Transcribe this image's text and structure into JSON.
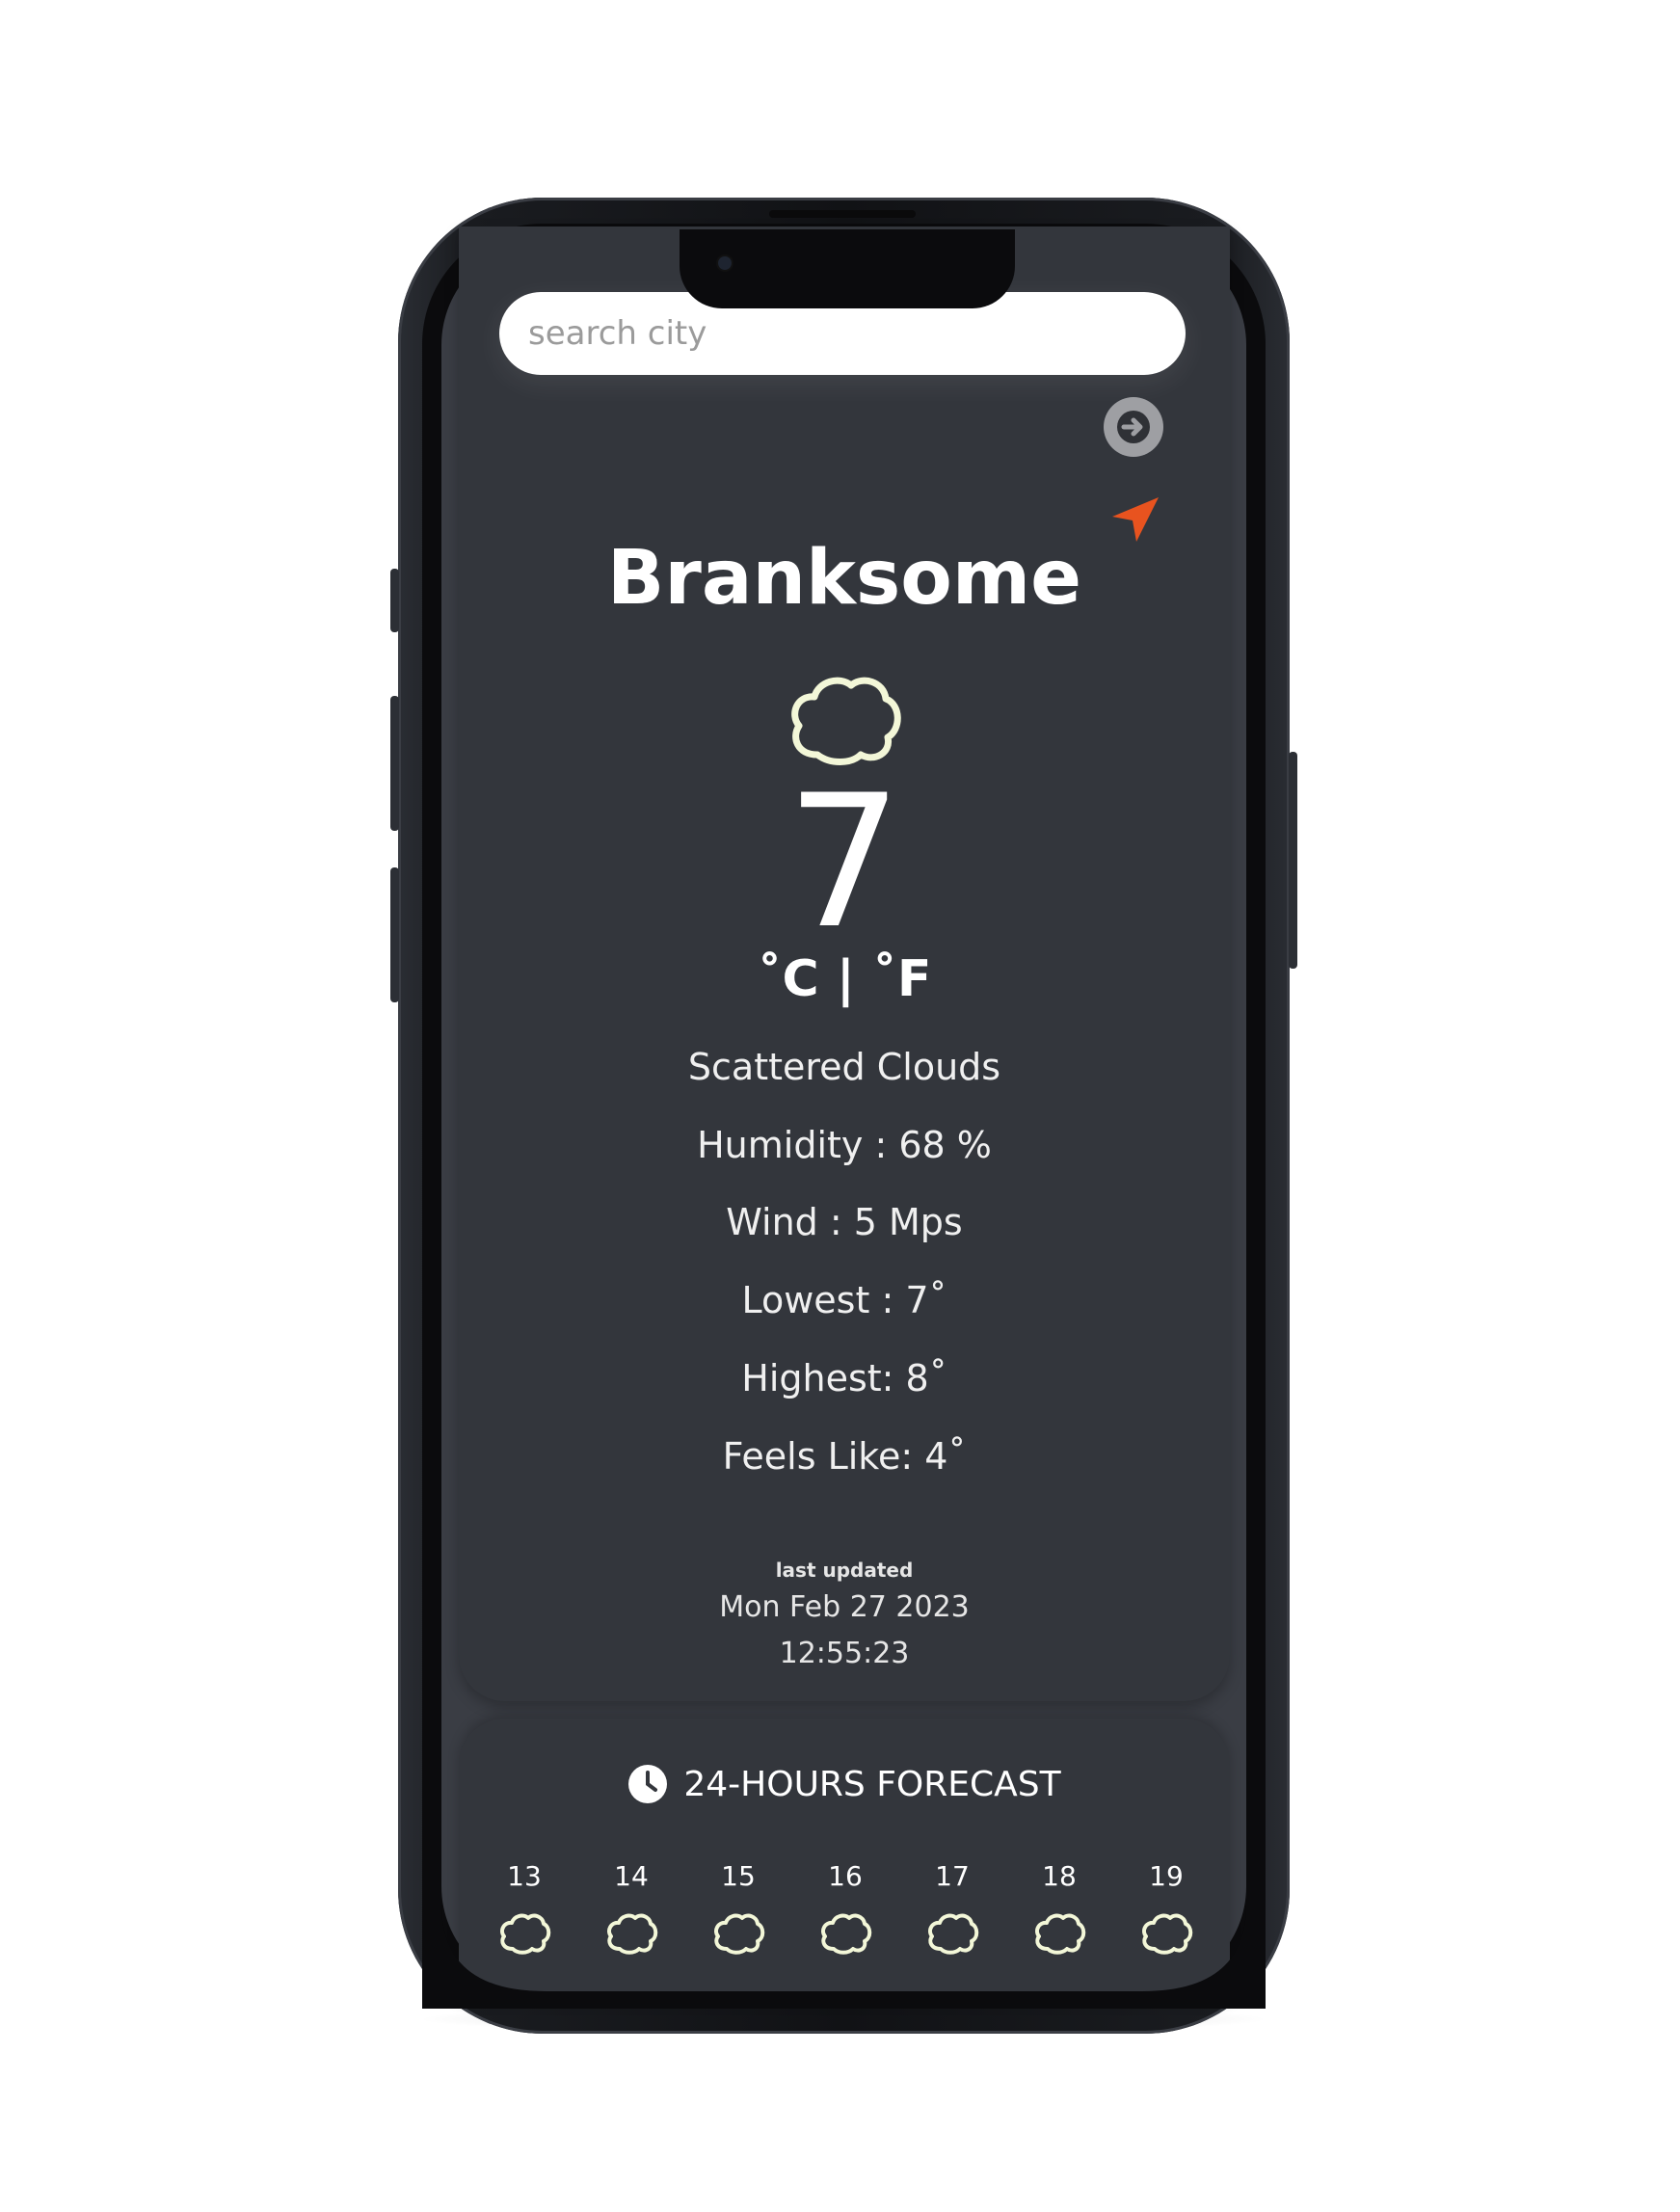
{
  "search": {
    "placeholder": "search city",
    "value": ""
  },
  "controls": {
    "submit_icon": "arrow-right-circle-icon",
    "location_icon": "location-arrow-icon",
    "location_color": "#e8531f"
  },
  "current": {
    "city": "Branksome",
    "condition_icon": "cloud-icon",
    "temperature": "7",
    "unit_celsius": "˚C",
    "unit_separator": "|",
    "unit_fahrenheit": "˚F",
    "description": "Scattered Clouds",
    "humidity": "Humidity : 68 %",
    "wind": "Wind : 5 Mps",
    "lowest": "Lowest : 7˚",
    "highest": "Highest: 8˚",
    "feels_like": "Feels Like: 4˚"
  },
  "updated": {
    "label": "last updated",
    "date": "Mon Feb 27 2023",
    "time": "12:55:23"
  },
  "forecast": {
    "title": "24-HOURS FORECAST",
    "title_icon": "clock-icon",
    "hours": [
      {
        "hour": "13",
        "icon": "cloud-icon"
      },
      {
        "hour": "14",
        "icon": "cloud-icon"
      },
      {
        "hour": "15",
        "icon": "cloud-icon"
      },
      {
        "hour": "16",
        "icon": "cloud-icon"
      },
      {
        "hour": "17",
        "icon": "cloud-icon"
      },
      {
        "hour": "18",
        "icon": "cloud-icon"
      },
      {
        "hour": "19",
        "icon": "cloud-icon"
      }
    ]
  },
  "colors": {
    "card": "#33363c",
    "screen_bg": "#3a3d44",
    "icon_stroke": "#f3f7d8",
    "accent": "#e8531f"
  }
}
